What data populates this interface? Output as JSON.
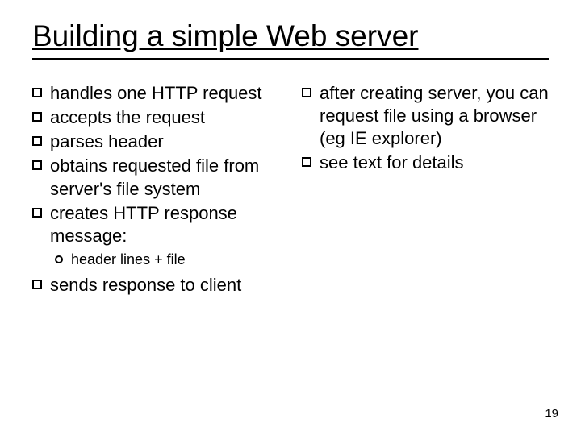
{
  "title": "Building a simple Web server",
  "left": [
    {
      "text": "handles one HTTP request"
    },
    {
      "text": "accepts the request"
    },
    {
      "text": "parses header"
    },
    {
      "text": "obtains requested file from server's file system"
    },
    {
      "text": "creates HTTP response message:",
      "sub": [
        {
          "text": "header lines + file"
        }
      ]
    },
    {
      "text": "sends response to client"
    }
  ],
  "right": [
    {
      "text": "after creating server, you can request file using a browser (eg IE explorer)"
    },
    {
      "text": "see  text for details"
    }
  ],
  "pageNumber": "19"
}
